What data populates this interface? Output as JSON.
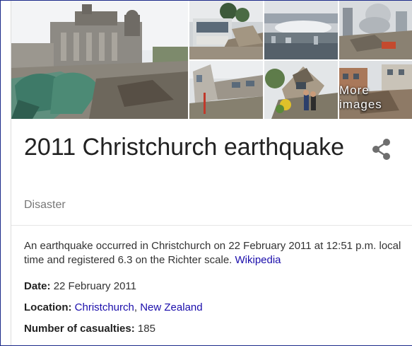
{
  "images": {
    "more_label": "More images"
  },
  "title": "2011 Christchurch earthquake",
  "subtitle": "Disaster",
  "icons": {
    "share": "share-icon"
  },
  "description": {
    "text": "An earthquake occurred in Christchurch on 22 February 2011 at 12:51 p.m. local time and registered 6.3 on the Richter scale.",
    "source_link": "Wikipedia"
  },
  "facts": [
    {
      "label": "Date:",
      "value": "22 February 2011"
    },
    {
      "label": "Location:",
      "links": [
        "Christchurch",
        "New Zealand"
      ],
      "separator": ", "
    },
    {
      "label": "Number of casualties:",
      "value": "185"
    }
  ],
  "colors": {
    "link": "#1a0dab",
    "frame": "#1c2a8a",
    "muted": "#777777"
  }
}
